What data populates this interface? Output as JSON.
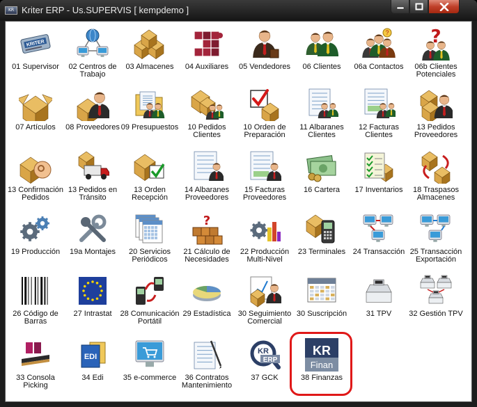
{
  "window": {
    "title": "Kriter ERP - Us.SUPERVIS [ kempdemo ]",
    "app_icon_text": "KR"
  },
  "colors": {
    "highlight": "#e01818",
    "close_button": "#c0402a",
    "titlebar": "#222222",
    "client_bg": "#ffffff"
  },
  "modules": [
    {
      "label": "01 Supervisor",
      "icon": "badge-icon"
    },
    {
      "label": "02 Centros de Trabajo",
      "icon": "network-icon"
    },
    {
      "label": "03 Almacenes",
      "icon": "boxes-icon"
    },
    {
      "label": "04 Auxiliares",
      "icon": "puzzle-icon"
    },
    {
      "label": "05 Vendedores",
      "icon": "salesman-icon"
    },
    {
      "label": "06 Clientes",
      "icon": "clients-icon"
    },
    {
      "label": "06a Contactos",
      "icon": "contacts-icon"
    },
    {
      "label": "06b Clientes Potenciales",
      "icon": "question-person-icon"
    },
    {
      "label": "07 Artículos",
      "icon": "open-box-icon"
    },
    {
      "label": "08 Proveedores",
      "icon": "box-person-icon"
    },
    {
      "label": "09 Presupuestos",
      "icon": "folder-people-icon"
    },
    {
      "label": "10 Pedidos Clientes",
      "icon": "boxes-people-icon"
    },
    {
      "label": "10 Orden de Preparación",
      "icon": "checkbox-box-icon"
    },
    {
      "label": "11 Albaranes Clientes",
      "icon": "document-people-icon"
    },
    {
      "label": "12 Facturas Clientes",
      "icon": "invoice-people-icon"
    },
    {
      "label": "13 Pedidos Proveedores",
      "icon": "boxes-person-icon"
    },
    {
      "label": "13 Confirmación Pedidos",
      "icon": "ok-hand-box-icon"
    },
    {
      "label": "13 Pedidos en Tránsito",
      "icon": "truck-icon"
    },
    {
      "label": "13 Orden Recepción",
      "icon": "box-check-icon"
    },
    {
      "label": "14 Albaranes Proveedores",
      "icon": "document-person-icon"
    },
    {
      "label": "15 Facturas Proveedores",
      "icon": "invoice-person-icon"
    },
    {
      "label": "16 Cartera",
      "icon": "money-icon"
    },
    {
      "label": "17 Inventarios",
      "icon": "checklist-icon"
    },
    {
      "label": "18 Traspasos Almacenes",
      "icon": "transfer-boxes-icon"
    },
    {
      "label": "19 Producción",
      "icon": "gears-icon"
    },
    {
      "label": "19a Montajes",
      "icon": "tools-icon"
    },
    {
      "label": "20 Servicios Periódicos",
      "icon": "calendar-icon"
    },
    {
      "label": "21 Cálculo de Necesidades",
      "icon": "blocks-question-icon"
    },
    {
      "label": "22 Producción Multi-Nivel",
      "icon": "gear-bars-icon"
    },
    {
      "label": "23 Terminales",
      "icon": "terminal-icon"
    },
    {
      "label": "24 Transacción",
      "icon": "computers-icon"
    },
    {
      "label": "25 Transacción Exportación",
      "icon": "computers-export-icon"
    },
    {
      "label": "26 Código de Barras",
      "icon": "barcode-icon"
    },
    {
      "label": "27 Intrastat",
      "icon": "eu-flag-icon"
    },
    {
      "label": "28 Comunicación Portátil",
      "icon": "phone-sync-icon"
    },
    {
      "label": "29 Estadística",
      "icon": "pie-chart-icon"
    },
    {
      "label": "30 Seguimiento Comercial",
      "icon": "chart-person-icon"
    },
    {
      "label": "30 Suscripción",
      "icon": "calendar-grid-icon"
    },
    {
      "label": "31 TPV",
      "icon": "cash-register-icon"
    },
    {
      "label": "32 Gestión TPV",
      "icon": "registers-network-icon"
    },
    {
      "label": "33 Consola Picking",
      "icon": "conveyor-icon"
    },
    {
      "label": "34 Edi",
      "icon": "edi-folder-icon"
    },
    {
      "label": "35 e-commerce",
      "icon": "cart-icon"
    },
    {
      "label": "36 Contratos Mantenimiento",
      "icon": "contract-pen-icon"
    },
    {
      "label": "37 GCK",
      "icon": "kr-erp-icon",
      "icon_text_top": "KR",
      "icon_text_bottom": "ERP"
    },
    {
      "label": "38 Finanzas",
      "icon": "kr-finan-icon",
      "icon_text_top": "KR",
      "icon_text_bottom": "Finan"
    }
  ]
}
